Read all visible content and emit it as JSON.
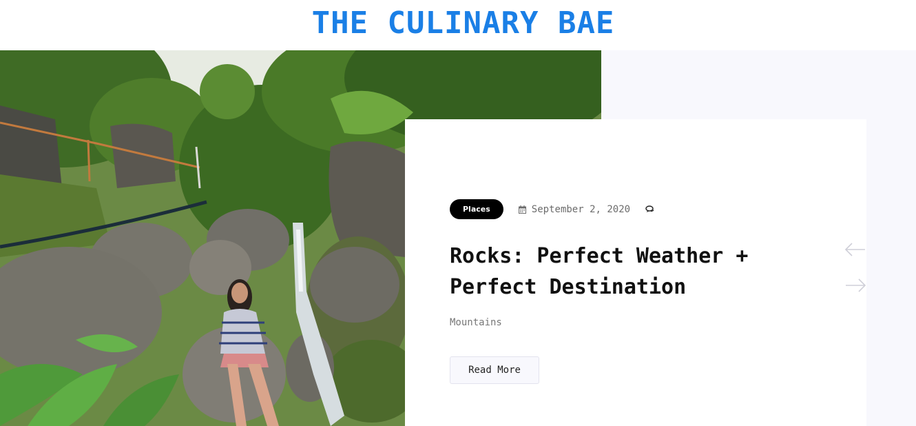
{
  "header": {
    "site_title": "THE CULINARY BAE"
  },
  "post": {
    "category": "Places",
    "date": "September 2, 2020",
    "title_line1": "Rocks: Perfect Weather +",
    "title_line2": "Perfect Destination",
    "excerpt": "Mountains",
    "read_more_label": "Read More"
  },
  "icons": {
    "date": "calendar-icon",
    "comments": "comment-icon",
    "prev": "arrow-left-icon",
    "next": "arrow-right-icon"
  },
  "colors": {
    "site_title": "#1a7fe6",
    "category_pill_bg": "#000000",
    "category_pill_text": "#ffffff",
    "right_panel_bg": "#f8f8fd",
    "card_bg": "#ffffff",
    "arrow": "#cfcfd8"
  }
}
